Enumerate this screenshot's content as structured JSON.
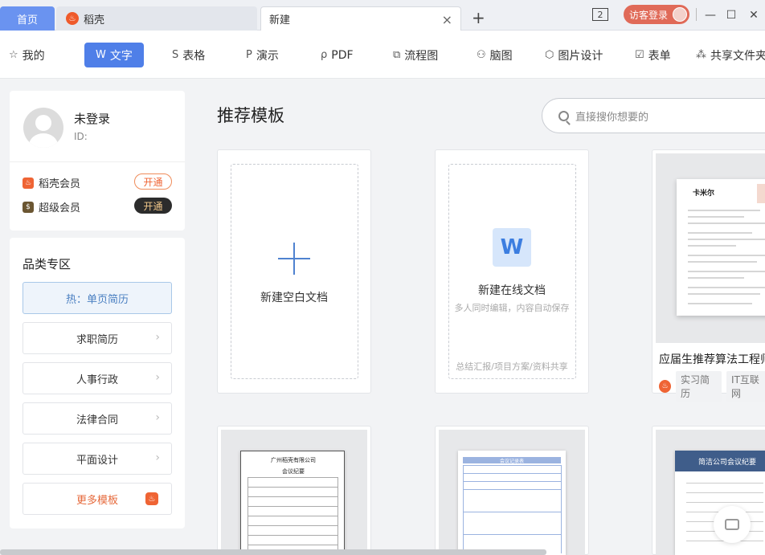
{
  "tabs": {
    "home": "首页",
    "daoke": "稻壳",
    "new": "新建",
    "close": "×",
    "add": "+"
  },
  "window": {
    "badge": "2",
    "guest_login": "访客登录",
    "minimize": "—",
    "maximize": "☐",
    "close": "✕"
  },
  "toolbar": {
    "items": [
      {
        "label": "我的",
        "icon": "star-icon"
      },
      {
        "label": "文字",
        "icon": "w-icon"
      },
      {
        "label": "表格",
        "icon": "s-icon"
      },
      {
        "label": "演示",
        "icon": "p-icon"
      },
      {
        "label": "PDF",
        "icon": "pdf-icon"
      },
      {
        "label": "流程图",
        "icon": "flow-icon"
      },
      {
        "label": "脑图",
        "icon": "mindmap-icon"
      },
      {
        "label": "图片设计",
        "icon": "image-design-icon"
      },
      {
        "label": "表单",
        "icon": "form-icon"
      },
      {
        "label": "共享文件夹",
        "icon": "share-folder-icon"
      }
    ]
  },
  "profile": {
    "name": "未登录",
    "id_label": "ID:",
    "members": [
      {
        "label": "稻壳会员",
        "action": "开通",
        "color": "#ef6434"
      },
      {
        "label": "超级会员",
        "action": "开通",
        "color": "#8a6a2e"
      }
    ]
  },
  "categories": {
    "title": "品类专区",
    "items": [
      "热：单页简历",
      "求职简历",
      "人事行政",
      "法律合同",
      "平面设计",
      "更多模板"
    ]
  },
  "main": {
    "title": "推荐模板",
    "search_placeholder": "直接搜你想要的",
    "blank_doc": "新建空白文档",
    "online_doc": "新建在线文档",
    "online_sub": "多人同时编辑，内容自动保存",
    "online_footer": "总结汇报/项目方案/资料共享",
    "resume_title": "应届生推荐算法工程师...",
    "resume_tags": [
      "实习简历",
      "IT互联网"
    ],
    "thumb_company": "广州稻壳有限公司",
    "thumb_minutes": "会议纪要",
    "thumb_record": "会议记录表",
    "thumb_simple": "简洁公司会议纪要",
    "resume_name": "卡米尔"
  }
}
